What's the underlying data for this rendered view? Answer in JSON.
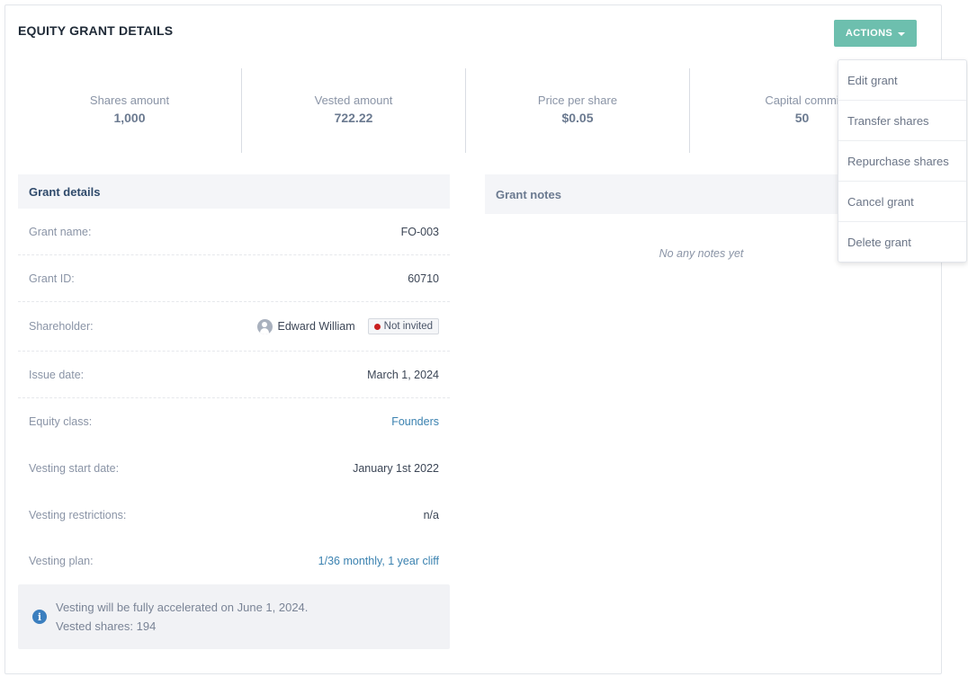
{
  "header": {
    "title": "EQUITY GRANT DETAILS",
    "actions_label": "ACTIONS"
  },
  "stats": [
    {
      "label": "Shares amount",
      "value": "1,000"
    },
    {
      "label": "Vested amount",
      "value": "722.22"
    },
    {
      "label": "Price per share",
      "value": "$0.05"
    },
    {
      "label": "Capital commi",
      "value": "50"
    }
  ],
  "grant_details": {
    "title": "Grant details",
    "rows": [
      {
        "label": "Grant name:",
        "value": "FO-003"
      },
      {
        "label": "Grant ID:",
        "value": "60710"
      },
      {
        "label": "Shareholder:",
        "value": "Edward William",
        "badge": "Not invited"
      },
      {
        "label": "Issue date:",
        "value": "March 1, 2024"
      },
      {
        "label": "Equity class:",
        "value": "Founders"
      },
      {
        "label": "Vesting start date:",
        "value": "January 1st 2022"
      },
      {
        "label": "Vesting restrictions:",
        "value": "n/a"
      },
      {
        "label": "Vesting plan:",
        "value": "1/36 monthly, 1 year cliff"
      }
    ],
    "info": {
      "line1": "Vesting will be fully accelerated on June 1, 2024.",
      "line2": "Vested shares: 194"
    }
  },
  "grant_notes": {
    "title": "Grant notes",
    "empty_text": "No any notes yet"
  },
  "actions_menu": [
    "Edit grant",
    "Transfer shares",
    "Repurchase shares",
    "Cancel grant",
    "Delete grant"
  ],
  "colors": {
    "accent": "#6dbfae",
    "link": "#3b82b0",
    "status_not_invited": "#c81e1e",
    "info_icon": "#3b7fbf"
  }
}
